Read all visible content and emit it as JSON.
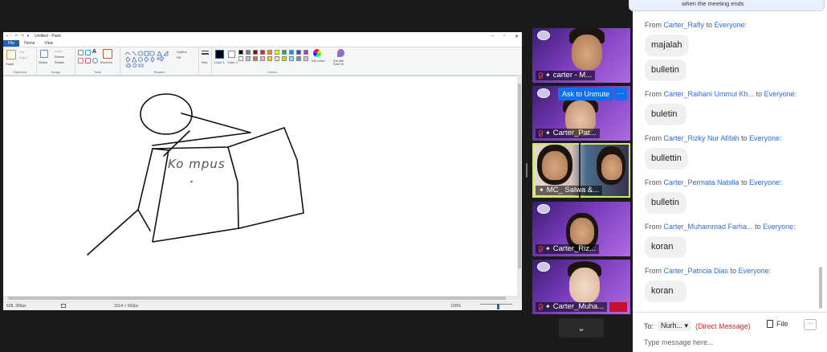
{
  "paint": {
    "title": "Untitled - Paint",
    "tabs": {
      "file": "File",
      "home": "Home",
      "view": "View"
    },
    "groups": {
      "clipboard": "Clipboard",
      "image": "Image",
      "tools": "Tools",
      "shapes": "Shapes",
      "colors": "Colors"
    },
    "buttons": {
      "paste": "Paste",
      "cut": "Cut",
      "copy": "Copy",
      "select": "Select",
      "crop": "Crop",
      "resize": "Resize",
      "rotate": "Rotate",
      "brushes": "Brushes",
      "outline": "Outline",
      "fill": "Fill",
      "size": "Size",
      "color1": "Color 1",
      "color2": "Color 2",
      "edit_colors": "Edit colors",
      "edit_paint3d": "Edit with Paint 3D"
    },
    "drawing_text": "Ko mpus",
    "status": {
      "cursor": "628, 396px",
      "canvas_size": "1014 × 592px",
      "zoom": "100%"
    },
    "palette": [
      "#000000",
      "#7f7f7f",
      "#880015",
      "#ed1c24",
      "#ff7f27",
      "#fff200",
      "#22b14c",
      "#00a2e8",
      "#3f48cc",
      "#a349a4",
      "#ffffff",
      "#c3c3c3",
      "#b97a57",
      "#ffaec9",
      "#ffc90e",
      "#efe4b0",
      "#b5e61d",
      "#99d9ea",
      "#7092be",
      "#c8bfe7"
    ]
  },
  "participants": [
    {
      "name": "carter - M..."
    },
    {
      "name": "Carter_Pat..."
    },
    {
      "name": "MC_ Salwa &..."
    },
    {
      "name": "Carter_Riz..."
    },
    {
      "name": "Carter_Muha..."
    }
  ],
  "ask_unmute": "Ask to Unmute",
  "more_label": "···",
  "strip_toggle": "⌄",
  "chat": {
    "banner": "when the meeting ends",
    "from_word": "From",
    "to_word": "to",
    "messages": [
      {
        "from": "Carter_Rafly",
        "to": "Everyone:",
        "text": "majalah"
      },
      {
        "from": "",
        "to": "",
        "text": "bulletin"
      },
      {
        "from": "Carter_Raihani Ummul Kh...",
        "to": "Everyone:",
        "text": "buletin"
      },
      {
        "from": "Carter_Rizky Nur Afifah",
        "to": "Everyone:",
        "text": "bullettin"
      },
      {
        "from": "Carter_Permata Nabilla",
        "to": "Everyone:",
        "text": "bulletin"
      },
      {
        "from": "Carter_Muhammad Farha...",
        "to": "Everyone:",
        "text": "koran"
      },
      {
        "from": "Carter_Patricia Dias",
        "to": "Everyone:",
        "text": "koran"
      }
    ],
    "to_label": "To:",
    "recipient": "Nurh...",
    "direct_message": "(Direct Message)",
    "file_label": "File",
    "more": "···",
    "input_placeholder": "Type message here..."
  }
}
